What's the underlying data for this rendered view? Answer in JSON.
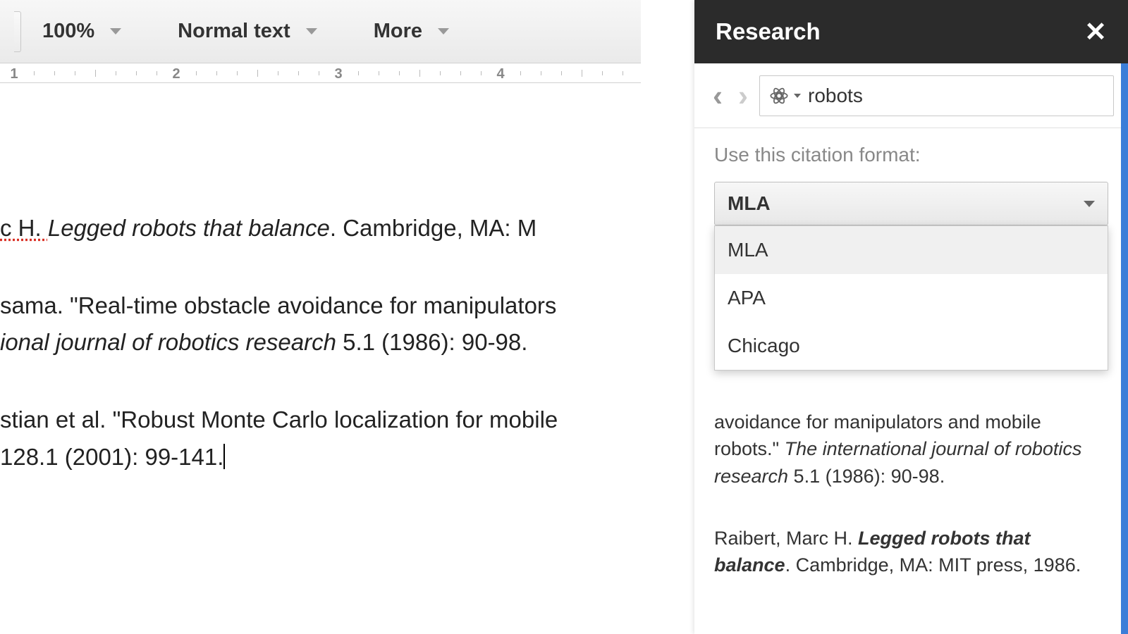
{
  "toolbar": {
    "zoom": "100%",
    "style": "Normal text",
    "more": "More"
  },
  "ruler": {
    "marks": [
      1,
      2,
      3,
      4
    ]
  },
  "doc": {
    "p1_author": "c H. ",
    "p1_title": "Legged robots that balance",
    "p1_rest": ". Cambridge, MA: M",
    "p2_line1": "sama. \"Real-time obstacle avoidance for manipulators",
    "p2_line2_journal": "ional journal of robotics research",
    "p2_line2_rest": " 5.1 (1986): 90-98.",
    "p3_line1": "stian et al. \"Robust Monte Carlo localization for mobile",
    "p3_line2": " 128.1 (2001): 99-141."
  },
  "research": {
    "title": "Research",
    "search_query": "robots",
    "citation_label": "Use this citation format:",
    "selected_format": "MLA",
    "options": [
      "MLA",
      "APA",
      "Chicago"
    ],
    "result1": {
      "prefix": "avoidance for manipulators and mobile robots.\" ",
      "journal": "The international journal of robotics research",
      "suffix": " 5.1 (1986): 90-98."
    },
    "result2": {
      "author": "Raibert, Marc H. ",
      "title": "Legged robots that balance",
      "suffix": ". Cambridge, MA: MIT press, 1986."
    }
  }
}
